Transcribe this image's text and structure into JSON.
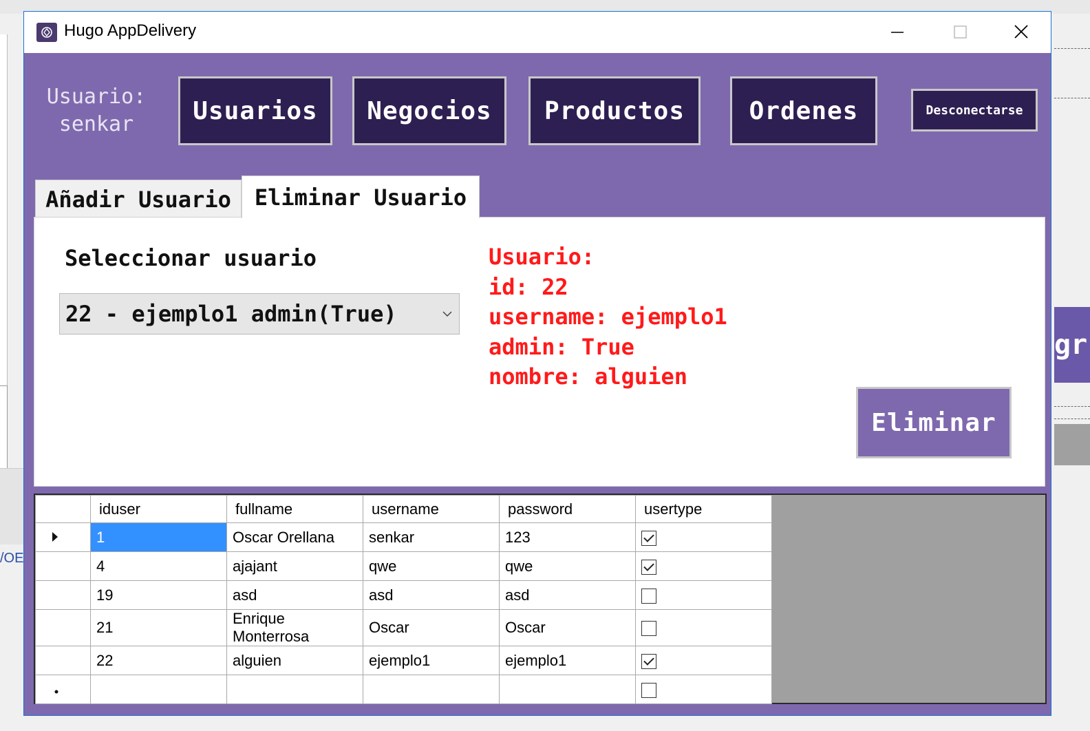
{
  "window": {
    "title": "Hugo AppDelivery"
  },
  "header": {
    "user_label": "Usuario:",
    "user_name": "senkar",
    "nav": {
      "usuarios": "Usuarios",
      "negocios": "Negocios",
      "productos": "Productos",
      "ordenes": "Ordenes"
    },
    "logout": "Desconectarse"
  },
  "tabs": {
    "add_user": "Añadir Usuario",
    "delete_user": "Eliminar Usuario",
    "active": "delete_user"
  },
  "delete_panel": {
    "select_label": "Seleccionar usuario",
    "selected_value": "22 - ejemplo1 admin(True)",
    "info": {
      "heading": "Usuario:",
      "id": "id: 22",
      "username": "username: ejemplo1",
      "admin": "admin: True",
      "nombre": "nombre: alguien"
    },
    "delete_button": "Eliminar"
  },
  "grid": {
    "columns": [
      "iduser",
      "fullname",
      "username",
      "password",
      "usertype"
    ],
    "rows": [
      {
        "iduser": "1",
        "fullname": "Oscar Orellana",
        "username": "senkar",
        "password": "123",
        "usertype": true
      },
      {
        "iduser": "4",
        "fullname": "ajajant",
        "username": "qwe",
        "password": "qwe",
        "usertype": true
      },
      {
        "iduser": "19",
        "fullname": "asd",
        "username": "asd",
        "password": "asd",
        "usertype": false
      },
      {
        "iduser": "21",
        "fullname": "Enrique Monterrosa",
        "username": "Oscar",
        "password": "Oscar",
        "usertype": false
      },
      {
        "iduser": "22",
        "fullname": "alguien",
        "username": "ejemplo1",
        "password": "ejemplo1",
        "usertype": true
      }
    ],
    "new_row_usertype": false
  },
  "background": {
    "left_fragment": "/OE",
    "right_fragment": "gr"
  },
  "colors": {
    "header_bg": "#7e69ae",
    "nav_button_bg": "#2e1f52",
    "info_text": "#ff1a1a",
    "selection": "#3390ff"
  }
}
